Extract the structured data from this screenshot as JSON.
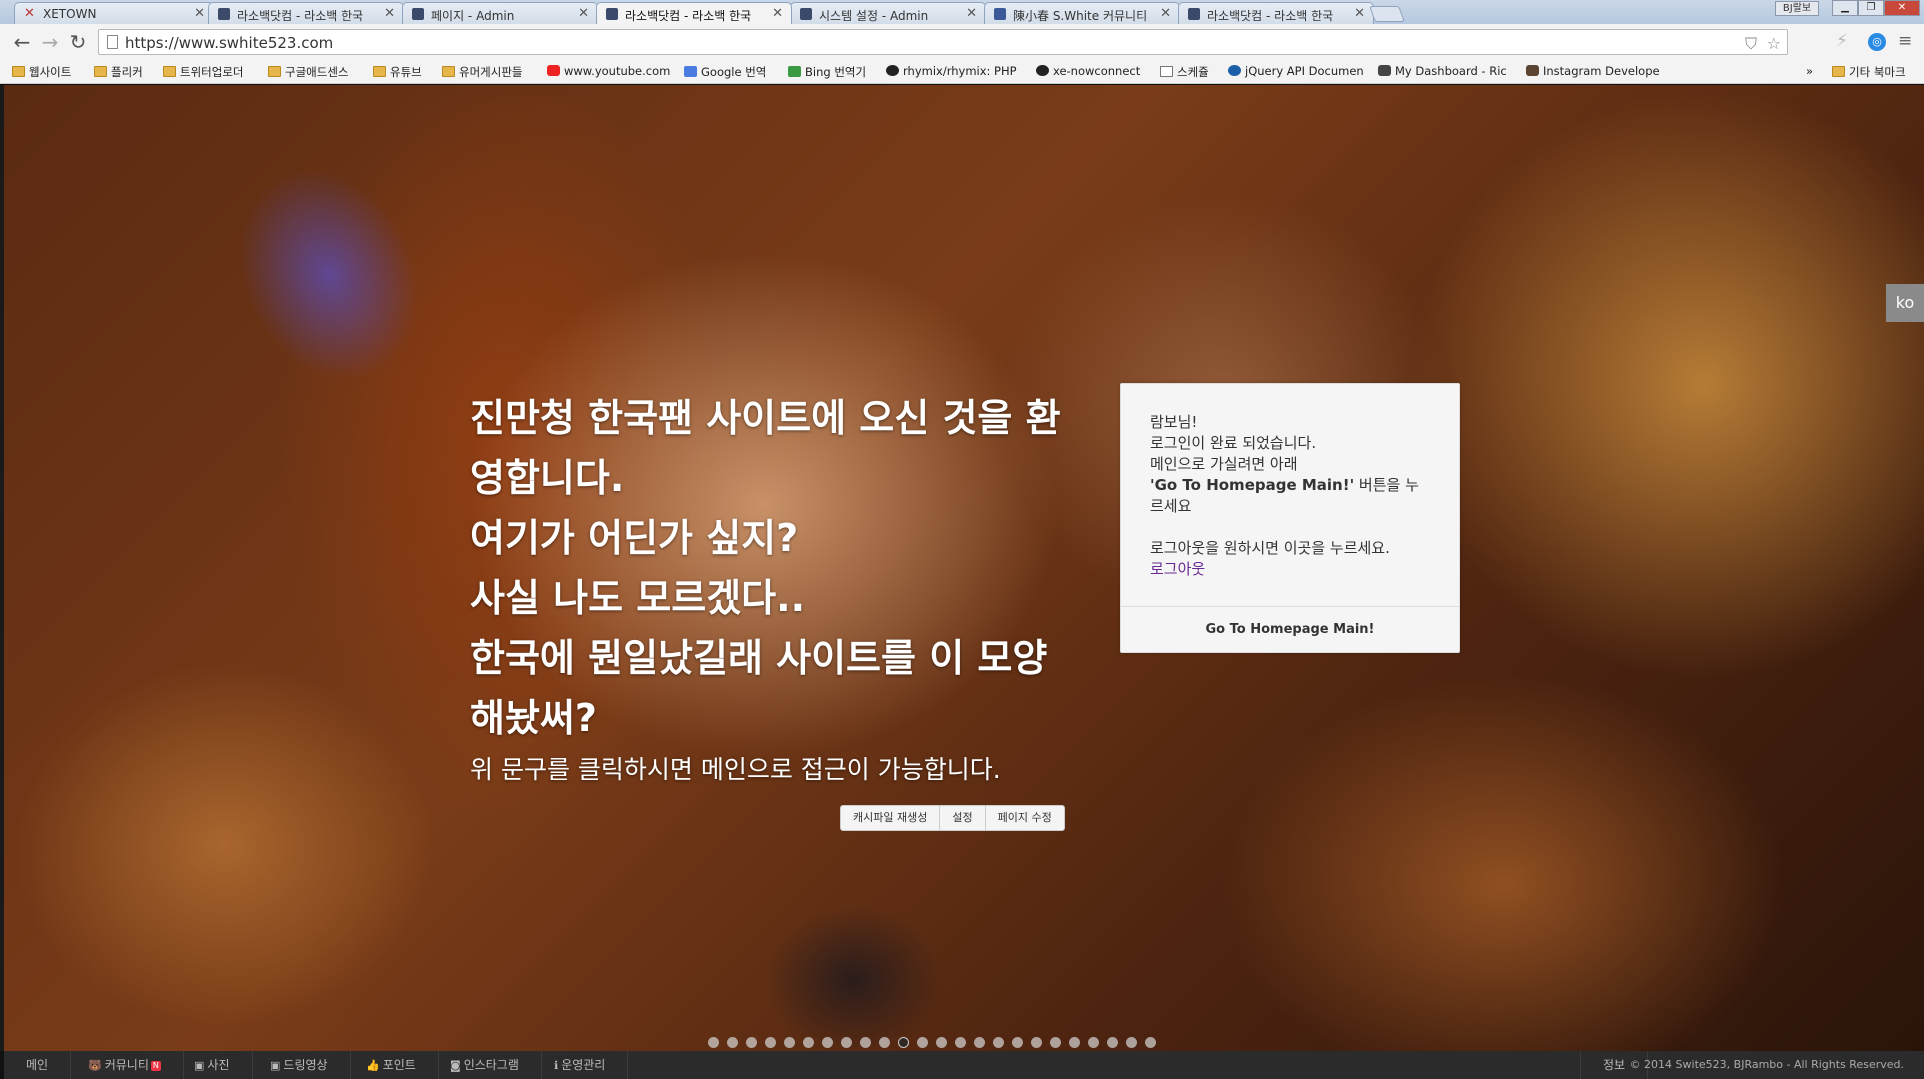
{
  "browser": {
    "tabs": [
      {
        "title": "XETOWN",
        "icon": "xe-icon"
      },
      {
        "title": "라소백닷컴 - 라소백 한국",
        "icon": "site-icon"
      },
      {
        "title": "페이지 - Admin",
        "icon": "site-icon"
      },
      {
        "title": "라소백닷컴 - 라소백 한국",
        "icon": "site-icon",
        "active": true
      },
      {
        "title": "시스템 설정 - Admin",
        "icon": "site-icon"
      },
      {
        "title": "陳小春 S.White 커뮤니티",
        "icon": "facebook-icon"
      },
      {
        "title": "라소백닷컴 - 라소백 한국",
        "icon": "site-icon"
      }
    ],
    "user_label": "BJ랄보",
    "url": "https://www.swhite523.com",
    "bookmarks": [
      {
        "label": "웹사이트",
        "icon": "folder"
      },
      {
        "label": "플리커",
        "icon": "folder"
      },
      {
        "label": "트위터업로더",
        "icon": "folder"
      },
      {
        "label": "구글애드센스",
        "icon": "folder"
      },
      {
        "label": "유튜브",
        "icon": "folder"
      },
      {
        "label": "유머게시판들",
        "icon": "folder"
      },
      {
        "label": "www.youtube.com",
        "icon": "yt"
      },
      {
        "label": "Google 번역",
        "icon": "gtr"
      },
      {
        "label": "Bing 번역기",
        "icon": "bing"
      },
      {
        "label": "rhymix/rhymix: PHP",
        "icon": "gh"
      },
      {
        "label": "xe-nowconnect",
        "icon": "gh"
      },
      {
        "label": "스케쥴",
        "icon": "doc"
      },
      {
        "label": "jQuery API Documen",
        "icon": "jq"
      },
      {
        "label": "My Dashboard - Ric",
        "icon": "heart"
      },
      {
        "label": "Instagram Develope",
        "icon": "ig"
      }
    ],
    "overflow_label": "»",
    "other_bookmarks": "기타 북마크"
  },
  "hero": {
    "headline": [
      "진만청 한국팬 사이트에 오신 것을 환",
      "영합니다.",
      "여기가 어딘가 싶지?",
      "사실 나도 모르겠다..",
      "한국에 뭔일났길래 사이트를 이 모양",
      "해놨써?"
    ],
    "subline": "위 문구를 클릭하시면 메인으로 접근이 가능합니다.",
    "admin_tools": [
      "캐시파일 재생성",
      "설정",
      "페이지 수정"
    ]
  },
  "login": {
    "greeting": "람보님!",
    "line1": "로그인이 완료 되었습니다.",
    "line2": "메인으로 가실려면 아래",
    "line3_bold": "'Go To Homepage Main!'",
    "line3_rest": " 버튼을 누",
    "line4": "르세요",
    "logout_text": "로그아웃을 원하시면 이곳을 누르세요.",
    "logout_link": "로그아웃",
    "go_button": "Go To Homepage Main!"
  },
  "lang_button": "ko",
  "slider": {
    "count": 24,
    "active_index": 10
  },
  "footer": {
    "items": [
      {
        "label": "메인",
        "icon": ""
      },
      {
        "label": "커뮤니티",
        "icon": "🐻",
        "badge": "N"
      },
      {
        "label": "사진",
        "icon": "▣"
      },
      {
        "label": "드링영상",
        "icon": "▣"
      },
      {
        "label": "포인트",
        "icon": "👍"
      },
      {
        "label": "인스타그램",
        "icon": "◙"
      },
      {
        "label": "운영관리",
        "icon": "ℹ"
      }
    ],
    "info": "정보",
    "copyright": "© 2014 Swite523, BJRambo - All Rights Reserved."
  },
  "colors": {
    "footer_bg": "#2b2b2b",
    "login_box_bg": "#f5f5f5",
    "logout_link": "#6a2a94",
    "lang_button_bg": "#8a8a8a"
  }
}
